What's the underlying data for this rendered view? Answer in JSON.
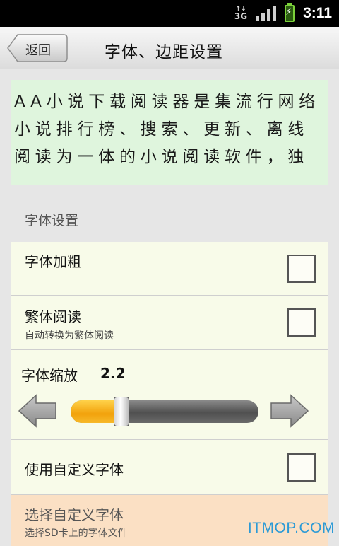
{
  "status_bar": {
    "network": "3G",
    "time": "3:11",
    "signal_bars": 4,
    "battery_charging": true
  },
  "title_bar": {
    "back_label": "返回",
    "title": "字体、边距设置"
  },
  "preview": {
    "text": "AA小说下载阅读器是集流行网络小说排行榜、搜索、更新、离线阅读为一体的小说阅读软件，独"
  },
  "settings": {
    "section_header": "字体设置",
    "bold": {
      "title": "字体加粗",
      "checked": false
    },
    "traditional": {
      "title": "繁体阅读",
      "subtitle": "自动转换为繁体阅读",
      "checked": false
    },
    "zoom": {
      "label": "字体缩放",
      "value": "2.2",
      "slider_fraction": 0.27
    },
    "custom_font": {
      "title": "使用自定义字体",
      "checked": false
    },
    "select_font": {
      "title": "选择自定义字体",
      "subtitle": "选择SD卡上的字体文件"
    }
  },
  "watermark": "ITMOP.COM",
  "colors": {
    "preview_bg": "#dff5dd",
    "row_bg": "#f8fbe9",
    "disabled_row_bg": "#fbe0c4",
    "slider_fill": "#f2a20c",
    "watermark": "#2b9ad6"
  }
}
